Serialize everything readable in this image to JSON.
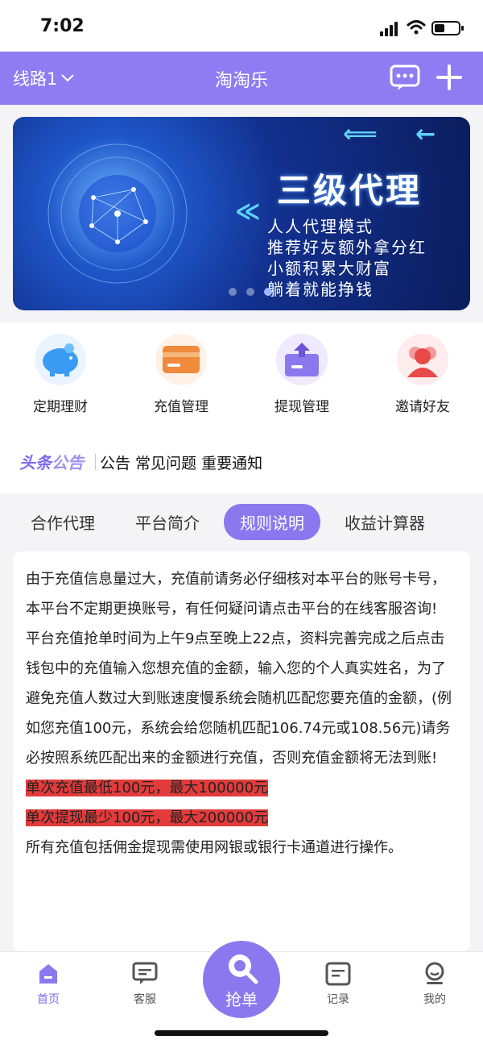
{
  "status_bar": {
    "time": "7:02"
  },
  "header": {
    "route_label": "线路1",
    "title": "淘淘乐"
  },
  "banner": {
    "headline": "三级代理",
    "lines": [
      "人人代理模式",
      "推荐好友额外拿分红",
      "小额积累大财富",
      "躺着就能挣钱"
    ],
    "dots": 3,
    "active_dot": 2
  },
  "quick_menu": [
    {
      "label": "定期理财",
      "icon": "piggy-bank-icon"
    },
    {
      "label": "充值管理",
      "icon": "card-icon"
    },
    {
      "label": "提现管理",
      "icon": "withdraw-icon"
    },
    {
      "label": "邀请好友",
      "icon": "invite-friends-icon"
    }
  ],
  "news": {
    "badge_a": "头条",
    "badge_b": "公告",
    "ticker": "公告 常见问题 重要通知"
  },
  "tabs": [
    {
      "label": "合作代理"
    },
    {
      "label": "平台简介"
    },
    {
      "label": "规则说明",
      "active": true
    },
    {
      "label": "收益计算器"
    }
  ],
  "content": {
    "p1": "由于充值信息量过大，充值前请务必仔细核对本平台的账号卡号，本平台不定期更换账号，有任何疑问请点击平台的在线客服咨询!",
    "p2": "平台充值抢单时间为上午9点至晚上22点，资料完善完成之后点击钱包中的充值输入您想充值的金额，输入您的个人真实姓名，为了避免充值人数过大到账速度慢系统会随机匹配您要充值的金额，(例如您充值100元，系统会给您随机匹配106.74元或108.56元)请务必按照系统匹配出来的金额进行充值，否则充值金额将无法到账!",
    "highlight1": "单次充值最低100元，最大100000元",
    "highlight2": "单次提现最少100元，最大200000元",
    "p3": "所有充值包括佣金提现需使用网银或银行卡通道进行操作。"
  },
  "bottom_nav": {
    "home": "首页",
    "service": "客服",
    "grab": "抢单",
    "records": "记录",
    "mine": "我的"
  },
  "colors": {
    "accent": "#8c78ee",
    "highlight": "#e23b3b"
  }
}
